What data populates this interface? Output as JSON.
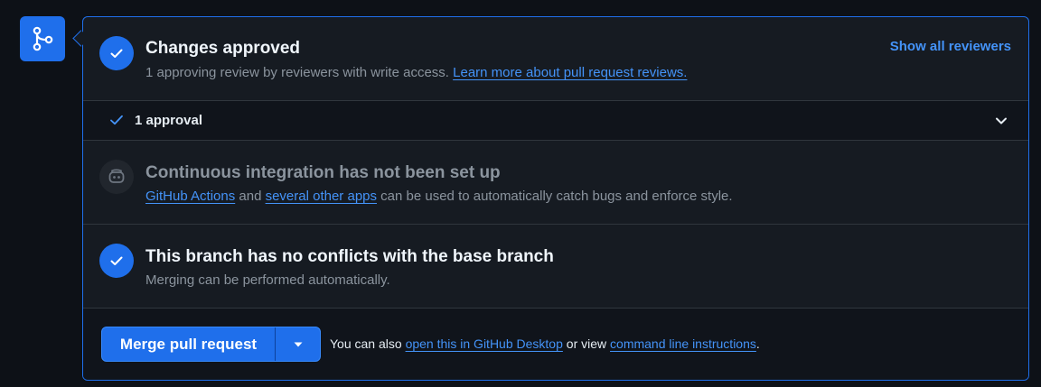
{
  "approved": {
    "title": "Changes approved",
    "description": "1 approving review by reviewers with write access.",
    "learn_more_link": "Learn more about pull request reviews.",
    "show_reviewers": "Show all reviewers"
  },
  "approvals": {
    "label": "1 approval"
  },
  "ci": {
    "title": "Continuous integration has not been set up",
    "link_actions": "GitHub Actions",
    "text_and": "and",
    "link_other_apps": "several other apps",
    "text_rest": "can be used to automatically catch bugs and enforce style."
  },
  "conflicts": {
    "title": "This branch has no conflicts with the base branch",
    "description": "Merging can be performed automatically."
  },
  "merge": {
    "button_label": "Merge pull request",
    "note_prefix": "You can also",
    "link_desktop": "open this in GitHub Desktop",
    "note_middle": "or view",
    "link_cli": "command line instructions",
    "note_suffix": "."
  },
  "colors": {
    "accent": "#1f6feb",
    "link": "#4493f8",
    "background": "#0d1117",
    "panel": "#161b22",
    "border": "#30363d",
    "muted_text": "#8b949e"
  },
  "icons": {
    "merge_badge": "git-merge-icon",
    "approved": "check-circle-icon",
    "approval_row": "check-icon",
    "expand": "chevron-down-icon",
    "ci": "robot-icon",
    "conflicts": "check-circle-icon",
    "dropdown": "triangle-down-icon"
  }
}
